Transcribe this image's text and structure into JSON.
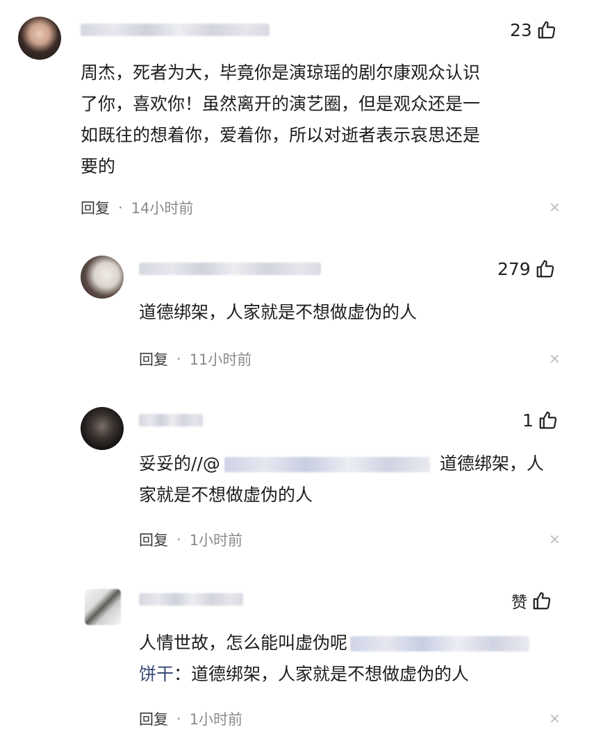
{
  "comments": [
    {
      "likes": "23",
      "lines": [
        "周杰，死者为大，毕竟你是演琼瑶的剧尔康观众认识",
        "了你，喜欢你！虽然离开的演艺圈，但是观众还是一",
        "如既往的想着你，爱着你，所以对逝者表示哀思还是",
        "要的"
      ],
      "reply_label": "回复",
      "time": "14小时前"
    },
    {
      "likes": "279",
      "lines": [
        "道德绑架，人家就是不想做虚伪的人"
      ],
      "reply_label": "回复",
      "time": "11小时前"
    },
    {
      "likes": "1",
      "line1_prefix": "妥妥的//@",
      "line1_suffix": "道德绑架，人",
      "line2": "家就是不想做虚伪的人",
      "reply_label": "回复",
      "time": "1小时前"
    },
    {
      "likes": "赞",
      "line1_prefix": "人情世故，怎么能叫虚伪呢",
      "line2_mention": "饼干",
      "line2_rest": "：道德绑架，人家就是不想做虚伪的人",
      "reply_label": "回复",
      "time": "1小时前"
    }
  ],
  "icons": {
    "like": "thumbs-up-icon",
    "close": "close-icon"
  },
  "separator": "·",
  "close_glyph": "×"
}
